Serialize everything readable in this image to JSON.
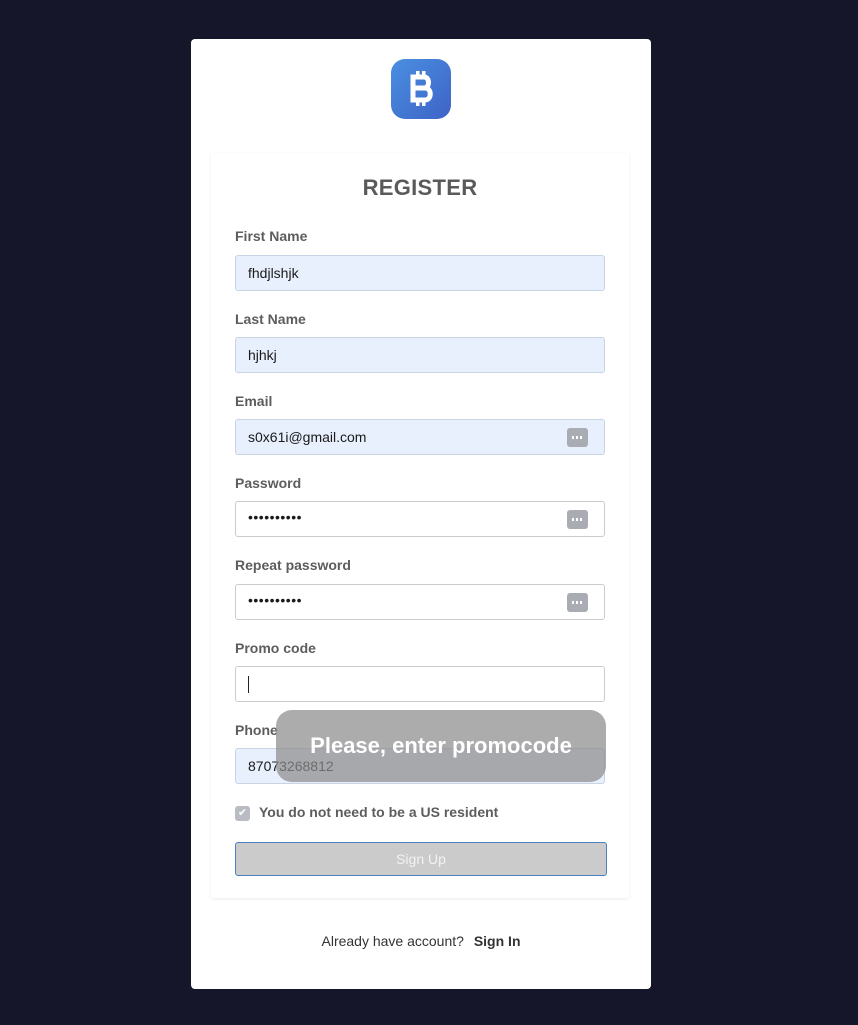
{
  "logo": {
    "icon": "bitcoin-icon",
    "glyph": "₿",
    "brand_color": "#4a7fd6"
  },
  "form": {
    "title": "REGISTER",
    "fields": {
      "first_name": {
        "label": "First Name",
        "value": "fhdjlshjk"
      },
      "last_name": {
        "label": "Last Name",
        "value": "hjhkj"
      },
      "email": {
        "label": "Email",
        "value": "s0x61i@gmail.com"
      },
      "password": {
        "label": "Password",
        "value": "••••••••••"
      },
      "repeat_password": {
        "label": "Repeat password",
        "value": "••••••••••"
      },
      "promo_code": {
        "label": "Promo code",
        "value": ""
      },
      "phone": {
        "label": "Phone",
        "value": "87073268812"
      }
    },
    "resident_checkbox": {
      "label": "You do not need to be a US resident",
      "checked": true
    },
    "submit_label": "Sign Up"
  },
  "toast": {
    "message": "Please, enter promocode"
  },
  "footer": {
    "prompt": "Already have account?",
    "signin_label": "Sign In"
  }
}
